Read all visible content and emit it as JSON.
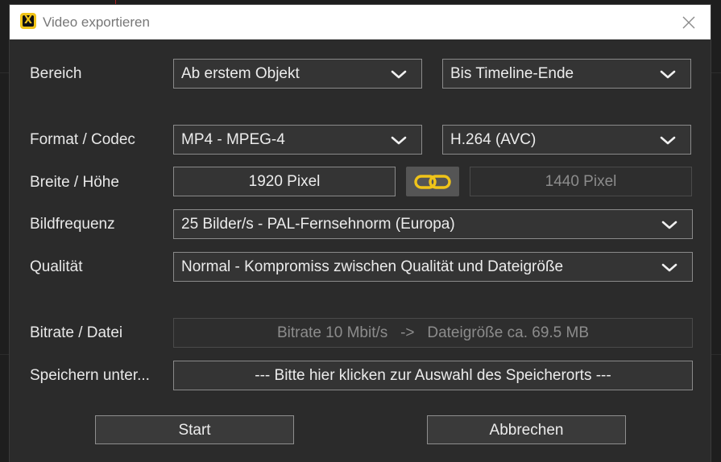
{
  "window": {
    "title": "Video exportieren",
    "app_icon_glyph": "X",
    "app_icon_color": "#f0c419",
    "close_icon": "close-icon"
  },
  "range": {
    "label": "Bereich",
    "from_value": "Ab erstem Objekt",
    "to_value": "Bis Timeline-Ende"
  },
  "format": {
    "label": "Format / Codec",
    "container_value": "MP4 - MPEG-4",
    "codec_value": "H.264 (AVC)"
  },
  "size": {
    "label": "Breite / Höhe",
    "width_value": "1920 Pixel",
    "height_value": "1440 Pixel",
    "link_icon": "chain-link-icon",
    "link_color": "#f0c419"
  },
  "framerate": {
    "label": "Bildfrequenz",
    "value": "25 Bilder/s - PAL-Fernsehnorm (Europa)"
  },
  "quality": {
    "label": "Qualität",
    "value": "Normal - Kompromiss zwischen Qualität und Dateigröße"
  },
  "bitrate": {
    "label": "Bitrate / Datei",
    "value": "Bitrate 10 Mbit/s   ->   Dateigröße ca. 69.5 MB"
  },
  "save": {
    "label": "Speichern unter...",
    "value": "--- Bitte hier klicken zur Auswahl des Speicherorts ---"
  },
  "actions": {
    "start_label": "Start",
    "cancel_label": "Abbrechen"
  }
}
